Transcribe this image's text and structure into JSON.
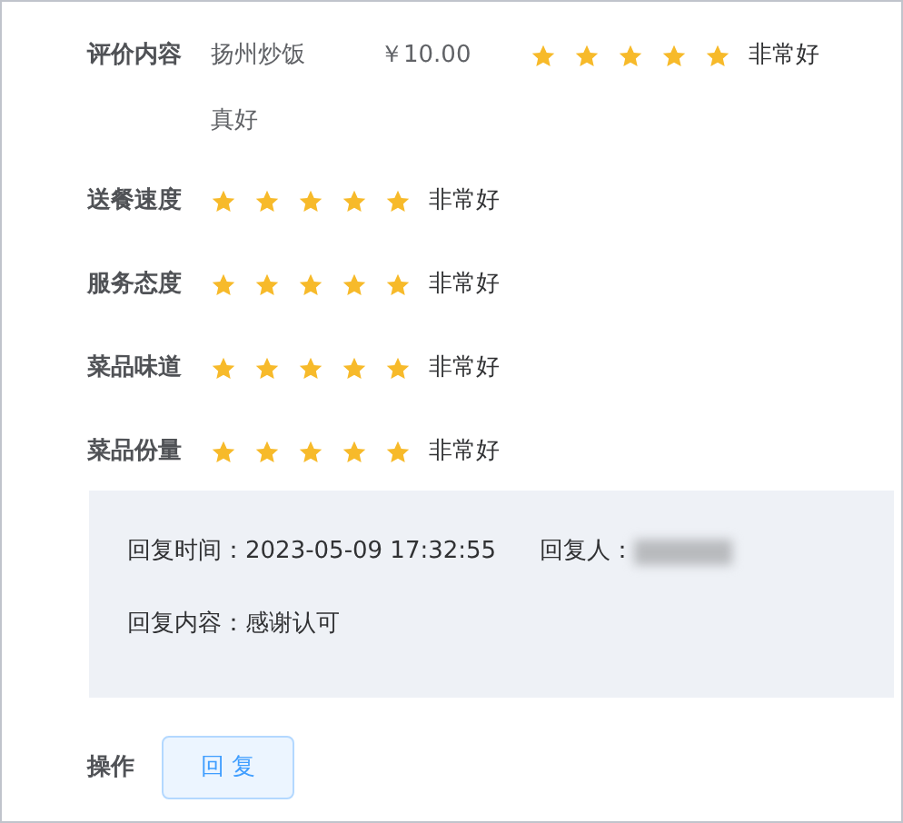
{
  "review": {
    "label": "评价内容",
    "dish": "扬州炒饭",
    "price": "￥10.00",
    "stars": 5,
    "rating_text": "非常好",
    "comment": "真好"
  },
  "ratings": [
    {
      "label": "送餐速度",
      "stars": 5,
      "rating_text": "非常好"
    },
    {
      "label": "服务态度",
      "stars": 5,
      "rating_text": "非常好"
    },
    {
      "label": "菜品味道",
      "stars": 5,
      "rating_text": "非常好"
    },
    {
      "label": "菜品份量",
      "stars": 5,
      "rating_text": "非常好"
    }
  ],
  "reply": {
    "time_label": "回复时间：",
    "time": "2023-05-09 17:32:55",
    "replier_label": "回复人：",
    "content_label": "回复内容：",
    "content": "感谢认可"
  },
  "actions": {
    "label": "操作",
    "buttons": [
      "回 复"
    ]
  }
}
